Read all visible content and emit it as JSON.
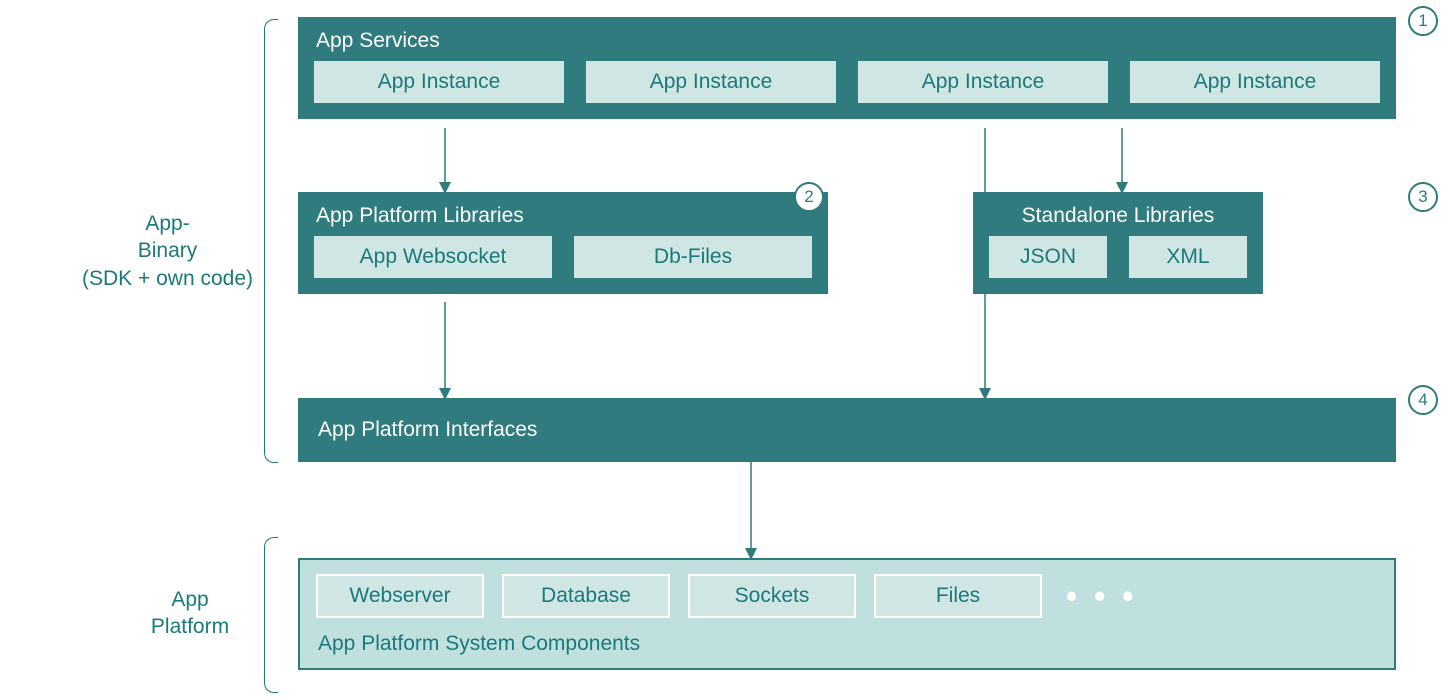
{
  "leftLabels": {
    "binary": "App-\nBinary\n(SDK + own code)",
    "platform": "App\nPlatform"
  },
  "boxes": {
    "services": {
      "title": "App Services",
      "items": [
        "App Instance",
        "App Instance",
        "App Instance",
        "App Instance"
      ],
      "badge": "1"
    },
    "platformLibs": {
      "title": "App Platform Libraries",
      "items": [
        "App Websocket",
        "Db-Files"
      ],
      "badge": "2"
    },
    "standaloneLibs": {
      "title": "Standalone Libraries",
      "items": [
        "JSON",
        "XML"
      ],
      "badge": "3"
    },
    "interfaces": {
      "title": "App Platform Interfaces",
      "badge": "4"
    },
    "system": {
      "title": "App Platform System Components",
      "items": [
        "Webserver",
        "Database",
        "Sockets",
        "Files"
      ],
      "ellipsis": "• • •"
    }
  }
}
